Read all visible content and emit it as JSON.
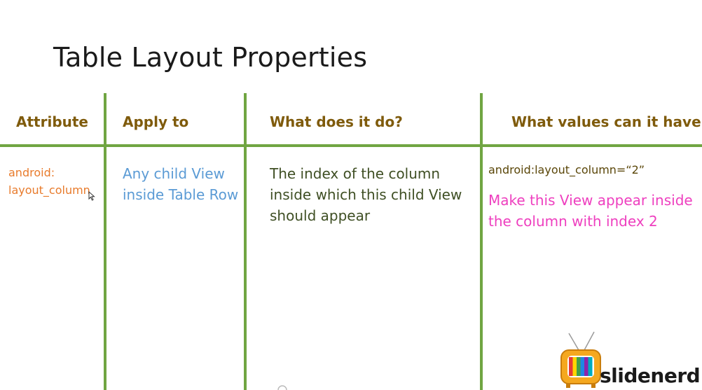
{
  "slide": {
    "title": "Table Layout Properties"
  },
  "table": {
    "headers": [
      "Attribute",
      "Apply to",
      "What does it do?",
      "What values can it have?"
    ],
    "row": {
      "attribute_lines": [
        "android:",
        "layout_column"
      ],
      "apply_to_lines": [
        "Any child View",
        "inside Table Row"
      ],
      "what_it_does_lines": [
        "The index of the column",
        "inside which this child View",
        "should appear"
      ],
      "value_example": "android:layout_column=“2”",
      "value_description_lines": [
        "Make this View appear inside",
        "the column with index 2"
      ]
    }
  },
  "logo": {
    "text": "slidenerd"
  },
  "colors": {
    "grid": "#70a542",
    "header_text": "#7f5b0c",
    "attribute_text": "#e87b2c",
    "apply_text": "#5b9bd5",
    "what_text": "#3f4f24",
    "value_code_text": "#5a4608",
    "value_desc_text": "#ee3fbf"
  },
  "icons": {
    "cursor": "mouse-cursor-icon",
    "logo": "tv-logo-icon",
    "loading": "loading-spinner-icon"
  }
}
